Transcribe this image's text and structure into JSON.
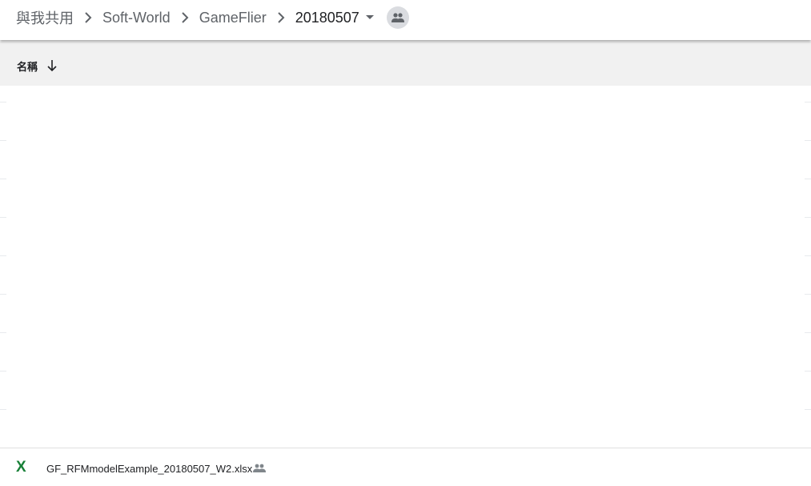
{
  "breadcrumb": {
    "items": [
      "與我共用",
      "Soft-World",
      "GameFlier",
      "20180507"
    ],
    "shared_icon": "people-icon",
    "dropdown_icon": "caret-down-icon"
  },
  "list_header": {
    "name_label": "名稱",
    "sort_icon": "arrow-down-icon"
  },
  "files": [
    {
      "name": "GF_RFMmodelExample_20180507_W2.xlsx",
      "type_icon": "excel-icon",
      "type_glyph": "X",
      "shared_icon": "people-icon"
    }
  ],
  "colors": {
    "excel_green": "#188038",
    "header_bg": "#f1f1f1",
    "chip_bg": "#dadce0"
  }
}
